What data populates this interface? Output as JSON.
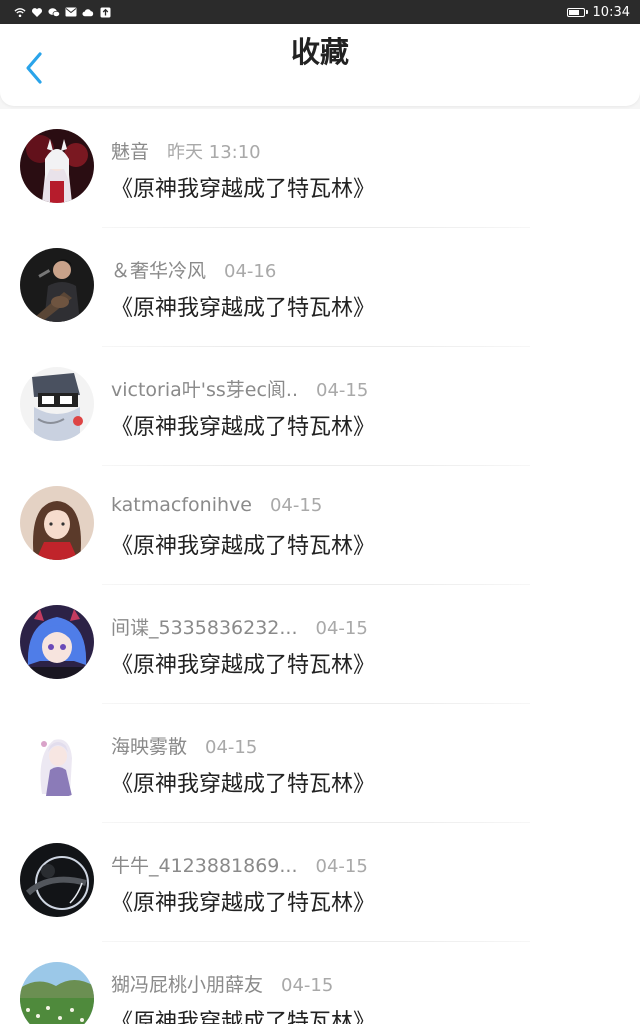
{
  "status_bar": {
    "icons": [
      "wifi-icon",
      "shield-icon",
      "wechat-icon",
      "mail-icon",
      "cloud-icon",
      "upload-icon"
    ],
    "battery_level": 0.8,
    "time": "10:34"
  },
  "header": {
    "title": "收藏",
    "back_icon": "chevron-left-icon",
    "accent": "#2aa4ea"
  },
  "items": [
    {
      "name": "魅音",
      "time": "昨天 13:10",
      "title": "《原神我穿越成了特瓦林》",
      "avatar": "anime-girl-red-avatar"
    },
    {
      "name": "＆奢华冷风",
      "time": "04-16",
      "title": "《原神我穿越成了特瓦林》",
      "avatar": "singer-guitar-avatar"
    },
    {
      "name": "victoria叶'ss芽ec阆..",
      "time": "04-15",
      "title": "《原神我穿越成了特瓦林》",
      "avatar": "cartoon-boy-avatar"
    },
    {
      "name": "katmacfonihve",
      "time": "04-15",
      "title": "《原神我穿越成了特瓦林》",
      "avatar": "girl-photo-avatar"
    },
    {
      "name": "间谍_5335836232...",
      "time": "04-15",
      "title": "《原神我穿越成了特瓦林》",
      "avatar": "blue-hair-anime-avatar"
    },
    {
      "name": "海映雾散",
      "time": "04-15",
      "title": "《原神我穿越成了特瓦林》",
      "avatar": "white-hair-anime-avatar"
    },
    {
      "name": "牛牛_4123881869...",
      "time": "04-15",
      "title": "《原神我穿越成了特瓦林》",
      "avatar": "dark-moon-avatar"
    },
    {
      "name": "猢冯屁桃小朋薛友",
      "time": "04-15",
      "title": "《原神我穿越成了特瓦林》",
      "avatar": "landscape-field-avatar"
    }
  ]
}
